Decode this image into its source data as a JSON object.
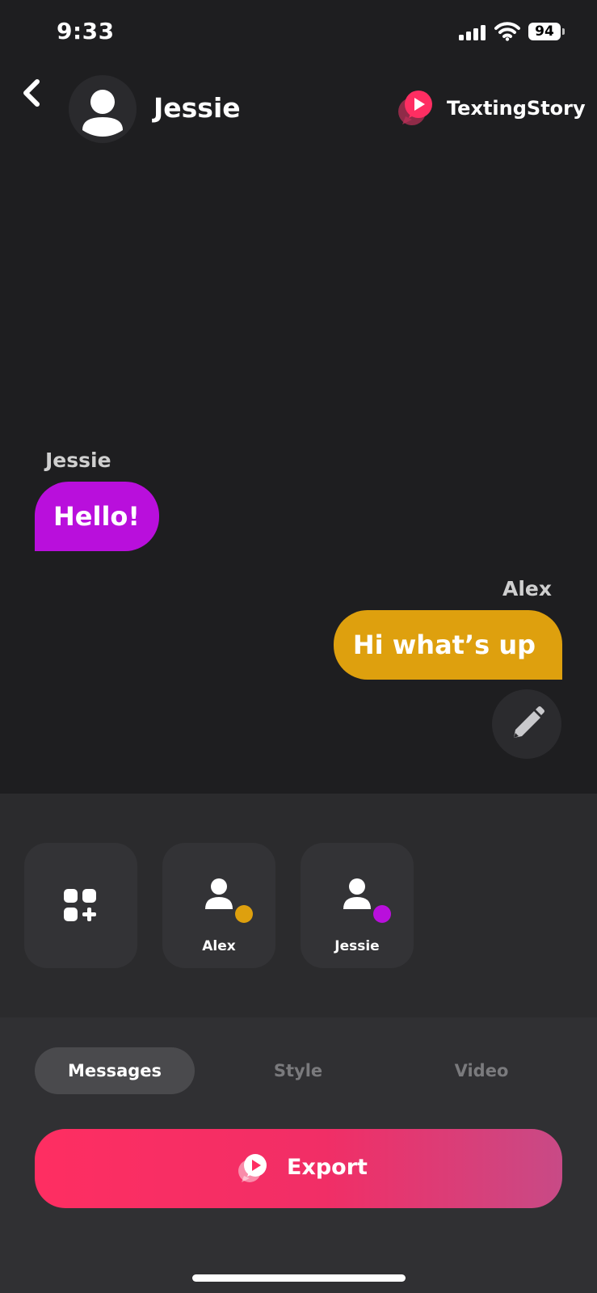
{
  "status_bar": {
    "time": "9:33",
    "battery": "94"
  },
  "header": {
    "contact_name": "Jessie",
    "brand": "TextingStory"
  },
  "chat": {
    "messages": [
      {
        "sender": "Jessie",
        "text": "Hello!",
        "color": "#b90fdc",
        "side": "left"
      },
      {
        "sender": "Alex",
        "text": "Hi what’s up",
        "color": "#dea00e",
        "side": "right"
      }
    ]
  },
  "participants": [
    {
      "name": "Alex",
      "color": "#dea00e"
    },
    {
      "name": "Jessie",
      "color": "#b90fdc"
    }
  ],
  "tabs": [
    {
      "label": "Messages",
      "active": true
    },
    {
      "label": "Style",
      "active": false
    },
    {
      "label": "Video",
      "active": false
    }
  ],
  "export_button": {
    "label": "Export"
  },
  "colors": {
    "accent": "#fe2e62",
    "background": "#1e1e20"
  },
  "icons": [
    "back-icon",
    "user-avatar-icon",
    "brand-logo-icon",
    "pencil-icon",
    "add-widgets-icon",
    "person-icon",
    "export-logo-icon"
  ]
}
